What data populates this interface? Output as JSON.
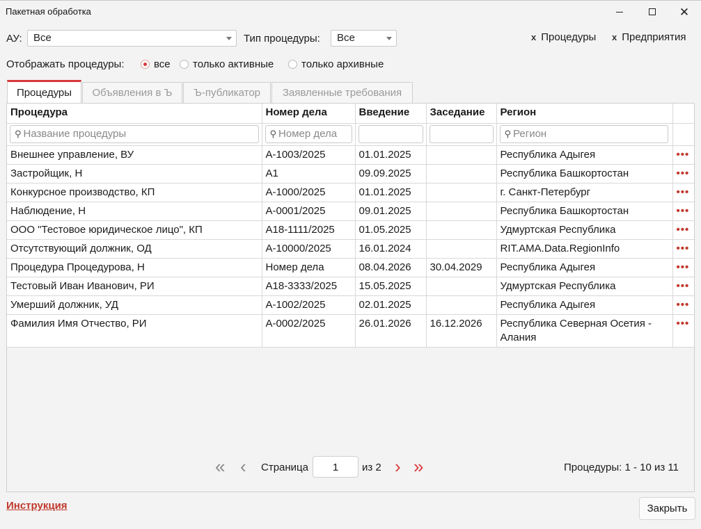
{
  "window": {
    "title": "Пакетная обработка"
  },
  "filters": {
    "au_label": "АУ:",
    "au_value": "Все",
    "type_label": "Тип процедуры:",
    "type_value": "Все",
    "chip_procedures": "Процедуры",
    "chip_enterprises": "Предприятия",
    "chip_remove_glyph": "x",
    "show_label": "Отображать процедуры:",
    "radio_all": "все",
    "radio_active": "только активные",
    "radio_archive": "только архивные",
    "radio_selected": "all"
  },
  "tabs": [
    "Процедуры",
    "Объявления в Ъ",
    "Ъ-публикатор",
    "Заявленные требования"
  ],
  "table": {
    "headers": [
      "Процедура",
      "Номер дела",
      "Введение",
      "Заседание",
      "Регион"
    ],
    "filter_placeholders": {
      "procedure": "Название процедуры",
      "case": "Номер дела",
      "region": "Регион"
    },
    "row_action_glyph": "•••",
    "rows": [
      [
        "Внешнее управление, ВУ",
        "А-1003/2025",
        "01.01.2025",
        "",
        "Республика Адыгея"
      ],
      [
        "Застройщик, Н",
        "А1",
        "09.09.2025",
        "",
        "Республика Башкортостан"
      ],
      [
        "Конкурсное производство, КП",
        "А-1000/2025",
        "01.01.2025",
        "",
        "г. Санкт-Петербург"
      ],
      [
        "Наблюдение, Н",
        "А-0001/2025",
        "09.01.2025",
        "",
        "Республика Башкортостан"
      ],
      [
        "ООО \"Тестовое юридическое лицо\", КП",
        "А18-1111/2025",
        "01.05.2025",
        "",
        "Удмуртская Республика"
      ],
      [
        "Отсутствующий должник, ОД",
        "А-10000/2025",
        "16.01.2024",
        "",
        "RIT.AMA.Data.RegionInfo"
      ],
      [
        "Процедура Процедурова, Н",
        "Номер дела",
        "08.04.2026",
        "30.04.2029",
        "Республика Адыгея"
      ],
      [
        "Тестовый Иван Иванович, РИ",
        "А18-3333/2025",
        "15.05.2025",
        "",
        "Удмуртская Республика"
      ],
      [
        "Умерший должник, УД",
        "А-1002/2025",
        "02.01.2025",
        "",
        "Республика Адыгея"
      ],
      [
        "Фамилия Имя Отчество, РИ",
        "А-0002/2025",
        "26.01.2026",
        "16.12.2026",
        "Республика Северная Осетия - Алания"
      ]
    ]
  },
  "pager": {
    "page_label": "Страница",
    "current_page": "1",
    "total_label": "из 2",
    "summary": "Процедуры: 1 - 10 из 11"
  },
  "footer": {
    "instruction_link": "Инструкция",
    "close_button": "Закрыть"
  },
  "colors": {
    "accent": "#d9383a",
    "link": "#c0392b"
  }
}
